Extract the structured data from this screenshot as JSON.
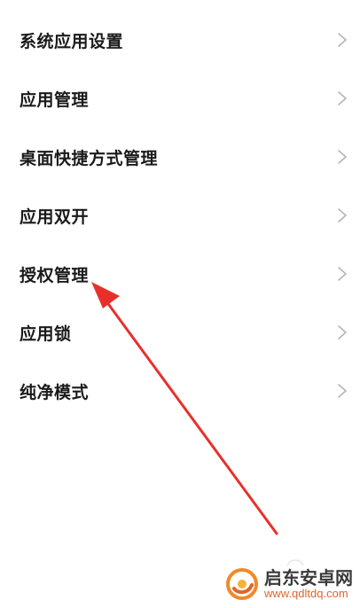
{
  "menu": {
    "items": [
      {
        "label": "系统应用设置"
      },
      {
        "label": "应用管理"
      },
      {
        "label": "桌面快捷方式管理"
      },
      {
        "label": "应用双开"
      },
      {
        "label": "授权管理"
      },
      {
        "label": "应用锁"
      },
      {
        "label": "纯净模式"
      }
    ]
  },
  "icons": {
    "chevron": "chevron-right-icon",
    "logo": "qidian-logo-icon"
  },
  "colors": {
    "arrow": "#e8302b",
    "chevron": "#b5b5b5",
    "watermark_accent": "#e0652a"
  },
  "watermark": {
    "name": "启东安卓网",
    "url": "www.qdltdq.com"
  }
}
